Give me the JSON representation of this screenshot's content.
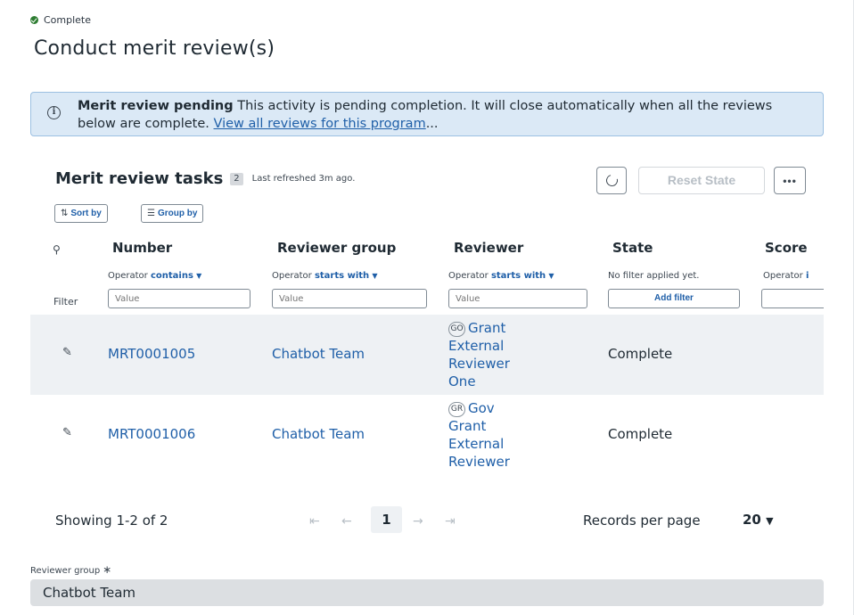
{
  "status": {
    "label": "Complete",
    "color": "#2e7d32"
  },
  "page_title": "Conduct merit review(s)",
  "banner": {
    "icon": "info-icon",
    "bold": "Merit review pending",
    "text": " This activity is pending completion. It will close automatically when all the reviews below are complete. ",
    "link": "View all reviews for this program",
    "link_suffix": "..."
  },
  "list": {
    "title": "Merit review tasks",
    "count": "2",
    "refreshed": "Last refreshed 3m ago.",
    "reset_label": "Reset State",
    "more_label": "•••",
    "sort_label": "Sort by",
    "group_label": "Group by",
    "filter_label": "Filter",
    "columns": [
      {
        "label": "Number",
        "operator_prefix": "Operator",
        "operator": "contains",
        "placeholder": "Value"
      },
      {
        "label": "Reviewer group",
        "operator_prefix": "Operator",
        "operator": "starts with",
        "placeholder": "Value"
      },
      {
        "label": "Reviewer",
        "operator_prefix": "Operator",
        "operator": "starts with",
        "placeholder": "Value"
      },
      {
        "label": "State",
        "no_filter": "No filter applied yet.",
        "add_filter": "Add filter"
      },
      {
        "label": "Score",
        "operator_prefix": "Operator",
        "operator": "i"
      }
    ],
    "rows": [
      {
        "number": "MRT0001005",
        "group": "Chatbot Team",
        "initials": "GO",
        "reviewer_lines": [
          "Grant",
          "External",
          "Reviewer",
          "One"
        ],
        "state": "Complete"
      },
      {
        "number": "MRT0001006",
        "group": "Chatbot Team",
        "initials": "GR",
        "reviewer_lines": [
          "Gov",
          "Grant",
          "External",
          "Reviewer"
        ],
        "state": "Complete"
      }
    ]
  },
  "pagination": {
    "showing": "Showing 1-2 of 2",
    "current_page": "1",
    "records_label": "Records per page",
    "records_value": "20"
  },
  "field": {
    "label": "Reviewer group",
    "required_mark": "∗",
    "value": "Chatbot Team"
  }
}
